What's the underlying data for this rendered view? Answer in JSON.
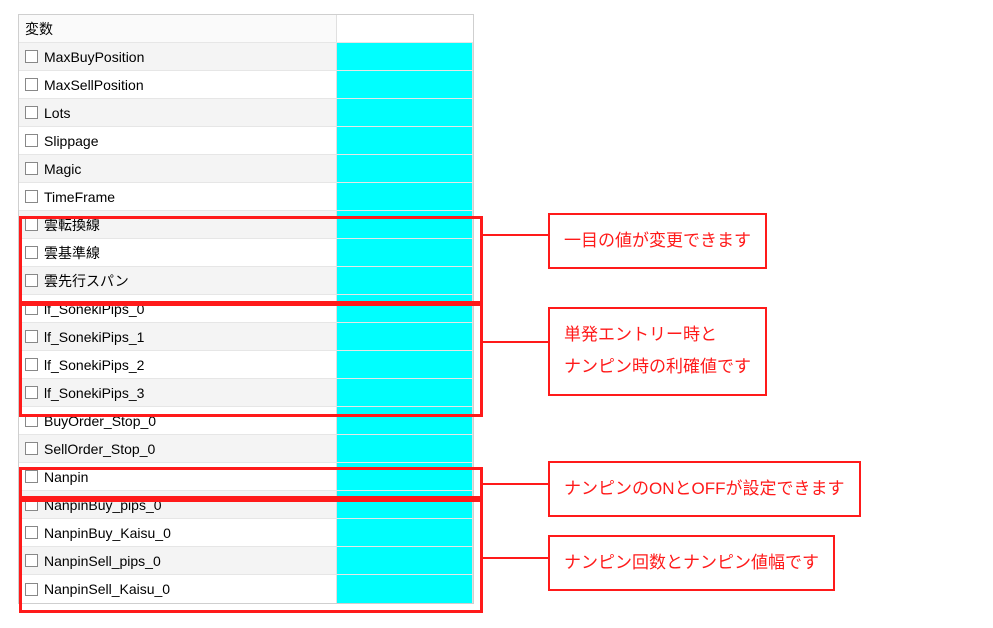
{
  "header": {
    "name_col": "変数"
  },
  "rows": [
    {
      "label": "MaxBuyPosition",
      "shaded": true
    },
    {
      "label": "MaxSellPosition",
      "shaded": false
    },
    {
      "label": "Lots",
      "shaded": true
    },
    {
      "label": "Slippage",
      "shaded": false
    },
    {
      "label": "Magic",
      "shaded": true
    },
    {
      "label": "TimeFrame",
      "shaded": false
    },
    {
      "label": "雲転換線",
      "shaded": true
    },
    {
      "label": "雲基準線",
      "shaded": false
    },
    {
      "label": "雲先行スパン",
      "shaded": true
    },
    {
      "label": "lf_SonekiPips_0",
      "shaded": false
    },
    {
      "label": "lf_SonekiPips_1",
      "shaded": true
    },
    {
      "label": "lf_SonekiPips_2",
      "shaded": false
    },
    {
      "label": "lf_SonekiPips_3",
      "shaded": true
    },
    {
      "label": "BuyOrder_Stop_0",
      "shaded": false
    },
    {
      "label": "SellOrder_Stop_0",
      "shaded": true
    },
    {
      "label": "Nanpin",
      "shaded": false
    },
    {
      "label": "NanpinBuy_pips_0",
      "shaded": true
    },
    {
      "label": "NanpinBuy_Kaisu_0",
      "shaded": false
    },
    {
      "label": "NanpinSell_pips_0",
      "shaded": true
    },
    {
      "label": "NanpinSell_Kaisu_0",
      "shaded": false
    }
  ],
  "callouts": {
    "c1": "一目の値が変更できます",
    "c2_line1": "単発エントリー時と",
    "c2_line2": "ナンピン時の利確値です",
    "c3": "ナンピンのONとOFFが設定できます",
    "c4": "ナンピン回数とナンピン値幅です"
  }
}
